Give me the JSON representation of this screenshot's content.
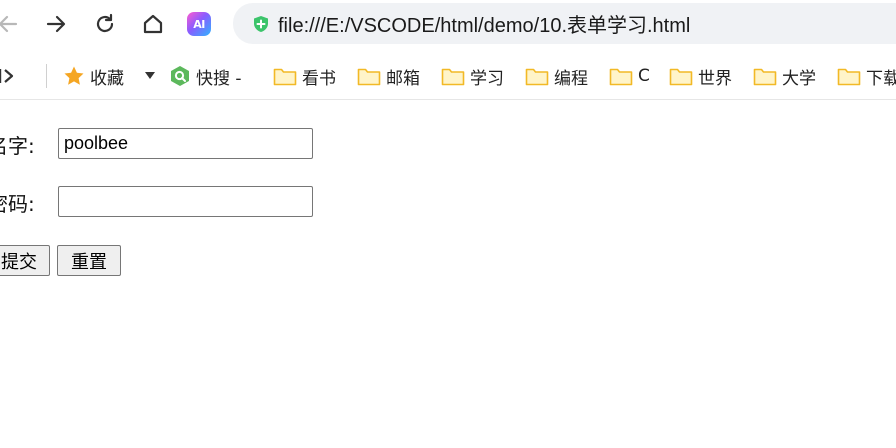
{
  "toolbar": {
    "url": "file:///E:/VSCODE/html/demo/10.表单学习.html",
    "ai_label": "AI"
  },
  "bookmarks": {
    "favorites_label": "收藏",
    "kuaisou_label": "快搜 -",
    "folders": [
      "看书",
      "邮箱",
      "学习",
      "编程",
      "C",
      "世界",
      "大学",
      "下载"
    ]
  },
  "form": {
    "name_label": "名字:",
    "name_value": "poolbee",
    "password_label": "密码:",
    "password_value": "",
    "submit_label": "提交",
    "reset_label": "重置"
  },
  "colors": {
    "star": "#f5a623",
    "folder": "#f7c23a",
    "kuaisou": "#5cb85c",
    "secure": "#3cc46b"
  },
  "icons": [
    "back-icon",
    "forward-icon",
    "reload-icon",
    "home-icon",
    "ai-icon",
    "secure-icon",
    "sidebar-toggle-icon",
    "star-icon",
    "kuaisou-icon",
    "folder-icon"
  ]
}
